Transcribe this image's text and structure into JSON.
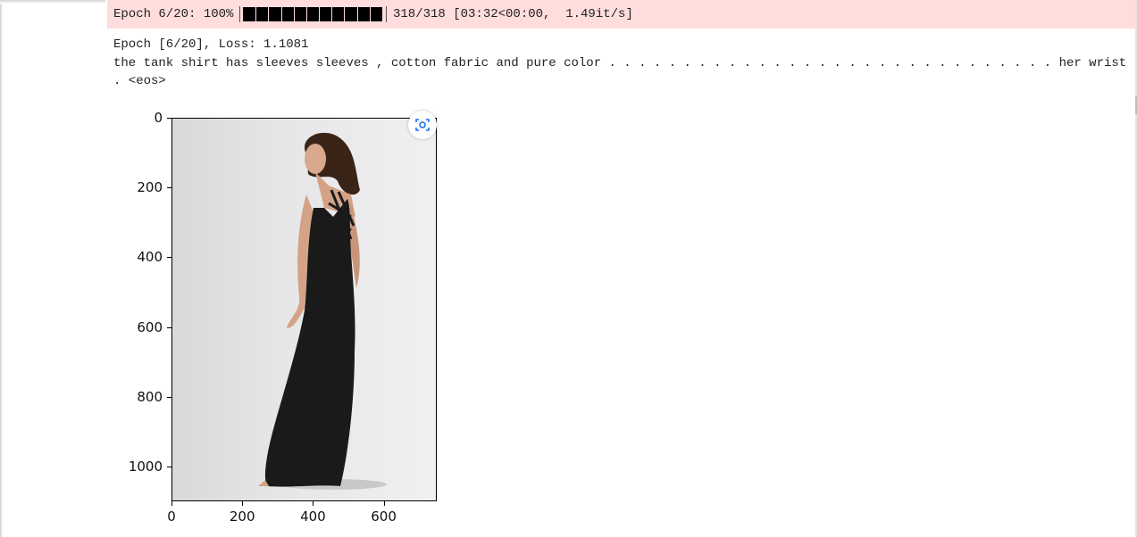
{
  "progress": {
    "prefix": "Epoch 6/20: 100%",
    "fraction": 1.0,
    "suffix": "318/318 [03:32<00:00,  1.49it/s]",
    "bg_color": "#ffdddd"
  },
  "stdout": {
    "line1": "Epoch [6/20], Loss: 1.1081",
    "line2": "the tank shirt has sleeves sleeves , cotton fabric and pure color . . . . . . . . . . . . . . . . . . . . . . . . . . . . . . her wrist",
    "line3": ". <eos>"
  },
  "figure": {
    "y_ticks": [
      "0",
      "200",
      "400",
      "600",
      "800",
      "1000"
    ],
    "x_ticks": [
      "0",
      "200",
      "400",
      "600"
    ],
    "image_description_icon": "camera-lens-icon",
    "dress_color": "#1a1a1a"
  }
}
